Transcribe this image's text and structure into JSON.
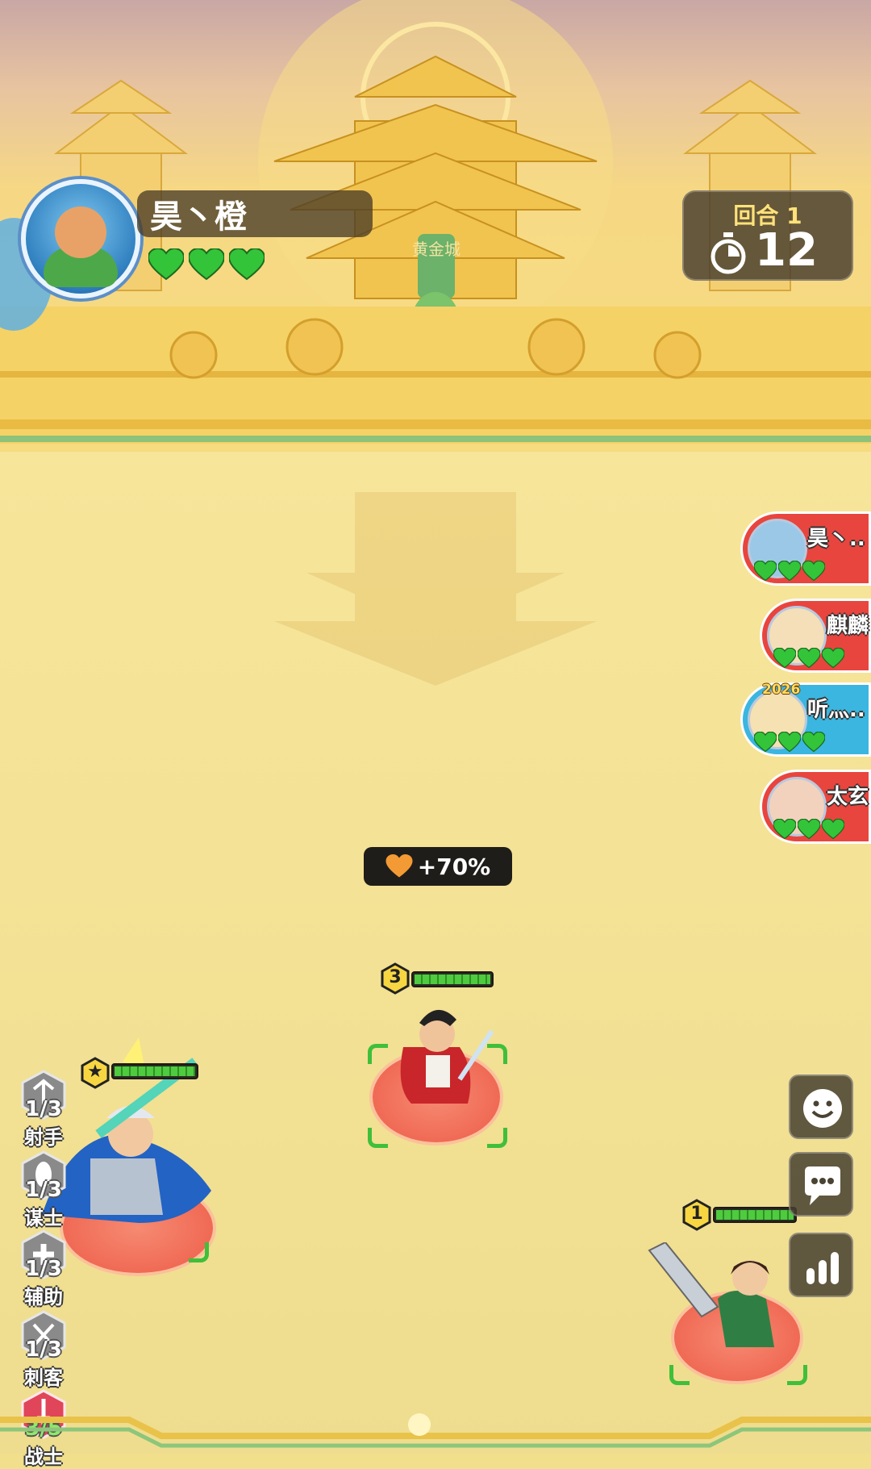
{
  "player": {
    "name": "昊丶橙",
    "hearts": 3
  },
  "round": {
    "label": "回合 1",
    "timer": "12"
  },
  "palace_sign": "黄金城",
  "opponents": [
    {
      "name": "昊丶..",
      "hearts": 3,
      "color": "#e8453e"
    },
    {
      "name": "麒麟",
      "hearts": 3,
      "color": "#e8453e"
    },
    {
      "name": "听灬..",
      "hearts": 3,
      "color": "#3ab6e0",
      "badge": "2026"
    },
    {
      "name": "太玄",
      "hearts": 3,
      "color": "#e8453e"
    }
  ],
  "buff": {
    "text": "+70%",
    "icon": "heart-icon"
  },
  "units": [
    {
      "name": "red-cloak-warrior",
      "level": "3",
      "hp": 1.0
    },
    {
      "name": "blue-armor-general",
      "level": "★",
      "hp": 1.0
    },
    {
      "name": "green-sword-heroine",
      "level": "1",
      "hp": 1.0
    }
  ],
  "class_rail": [
    {
      "count": "1/3",
      "label": "射手",
      "icon": "archer-icon"
    },
    {
      "count": "1/3",
      "label": "谋士",
      "icon": "strategist-icon"
    },
    {
      "count": "1/3",
      "label": "辅助",
      "icon": "support-icon"
    },
    {
      "count": "1/3",
      "label": "刺客",
      "icon": "assassin-icon"
    },
    {
      "count": "3/5",
      "label": "战士",
      "icon": "warrior-icon",
      "active": true
    }
  ],
  "side_buttons": [
    {
      "icon": "emoji-icon"
    },
    {
      "icon": "chat-icon"
    },
    {
      "icon": "stats-icon"
    }
  ],
  "colors": {
    "heart_green": "#33c43a",
    "opponent_red": "#e8453e",
    "opponent_blue": "#3ab6e0",
    "gold": "#f4d96b"
  }
}
